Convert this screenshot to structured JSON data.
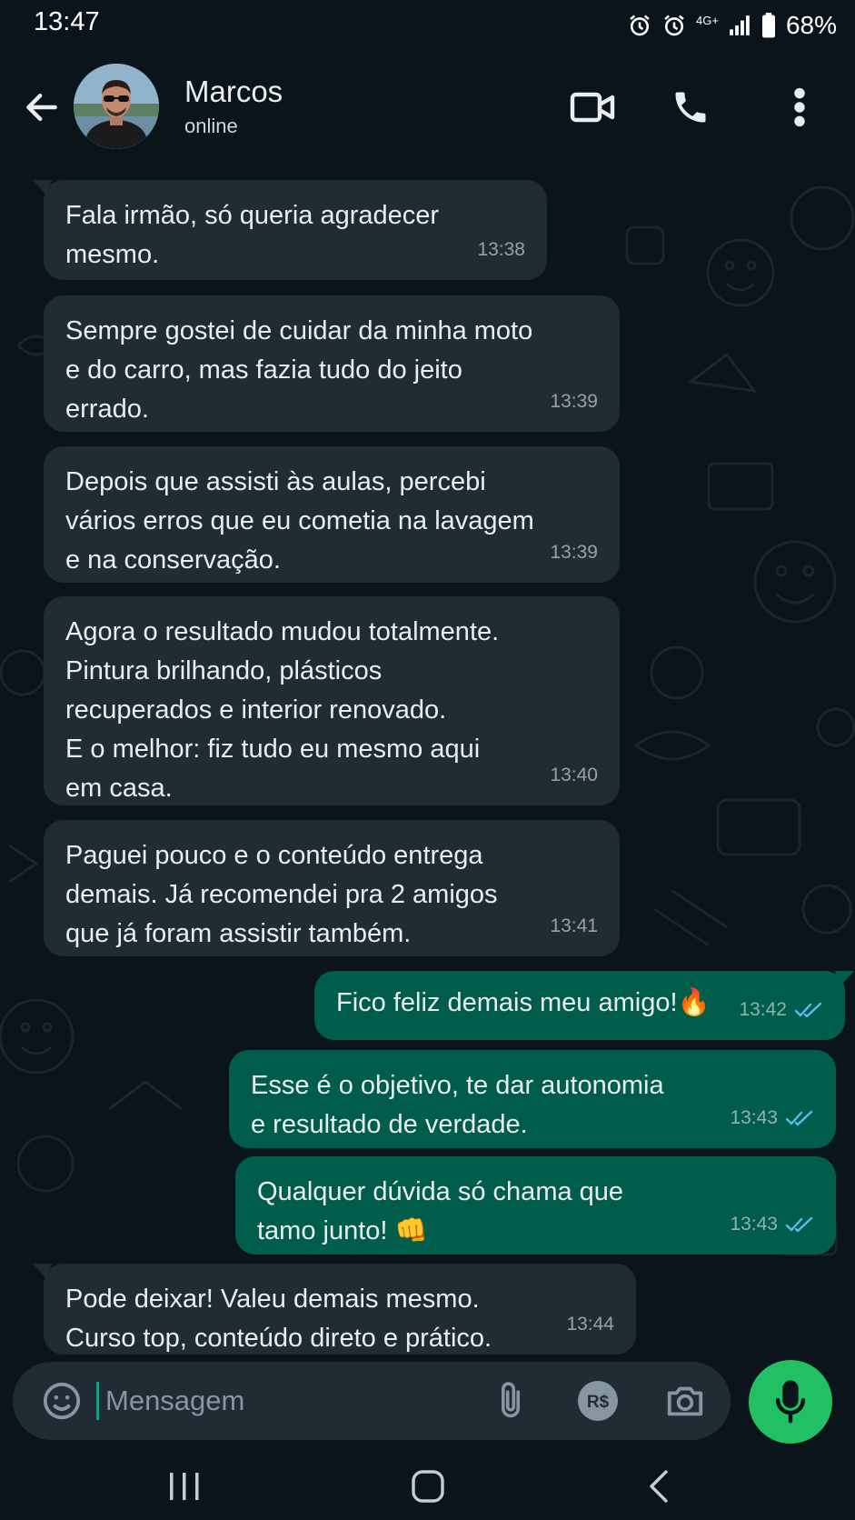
{
  "status_bar": {
    "time": "13:47",
    "network": "4G+",
    "battery": "68%"
  },
  "header": {
    "contact_name": "Marcos",
    "contact_status": "online",
    "icons": [
      "back-arrow-icon",
      "video-call-icon",
      "phone-icon",
      "more-vert-icon"
    ]
  },
  "messages": [
    {
      "direction": "in",
      "text": "Fala irmão, só queria agradecer\nmesmo.",
      "time": "13:38"
    },
    {
      "direction": "in",
      "text": "Sempre gostei de cuidar da minha moto\ne do carro, mas fazia tudo do jeito\nerrado.",
      "time": "13:39"
    },
    {
      "direction": "in",
      "text": "Depois que assisti às aulas, percebi\nvários erros que eu cometia na lavagem\ne na conservação.",
      "time": "13:39"
    },
    {
      "direction": "in",
      "text": "Agora o resultado mudou totalmente.\nPintura brilhando, plásticos\nrecuperados e interior renovado.\nE o melhor: fiz tudo eu mesmo aqui\nem casa.",
      "time": "13:40"
    },
    {
      "direction": "in",
      "text": "Paguei pouco e o conteúdo entrega\ndemais. Já recomendei pra 2 amigos\nque já foram assistir também.",
      "time": "13:41"
    },
    {
      "direction": "out",
      "text": "Fico feliz demais meu amigo!🔥",
      "time": "13:42",
      "status": "read"
    },
    {
      "direction": "out",
      "text": "Esse é o objetivo, te dar autonomia\ne resultado de verdade.",
      "time": "13:43",
      "status": "read"
    },
    {
      "direction": "out",
      "text": "Qualquer dúvida só chama que\ntamo junto! 👊",
      "time": "13:43",
      "status": "read"
    },
    {
      "direction": "in",
      "text": "Pode deixar! Valeu demais mesmo.\nCurso top, conteúdo direto e prático.",
      "time": "13:44"
    }
  ],
  "input": {
    "placeholder": "Mensagem",
    "icons": [
      "emoji-icon",
      "attach-icon",
      "payment-icon",
      "camera-icon",
      "mic-icon"
    ],
    "payment_label": "R$"
  },
  "colors": {
    "background": "#0b141a",
    "incoming_bubble": "#1f2c34",
    "outgoing_bubble": "#005c4b",
    "read_ticks": "#53bdeb",
    "accent": "#21c063"
  }
}
